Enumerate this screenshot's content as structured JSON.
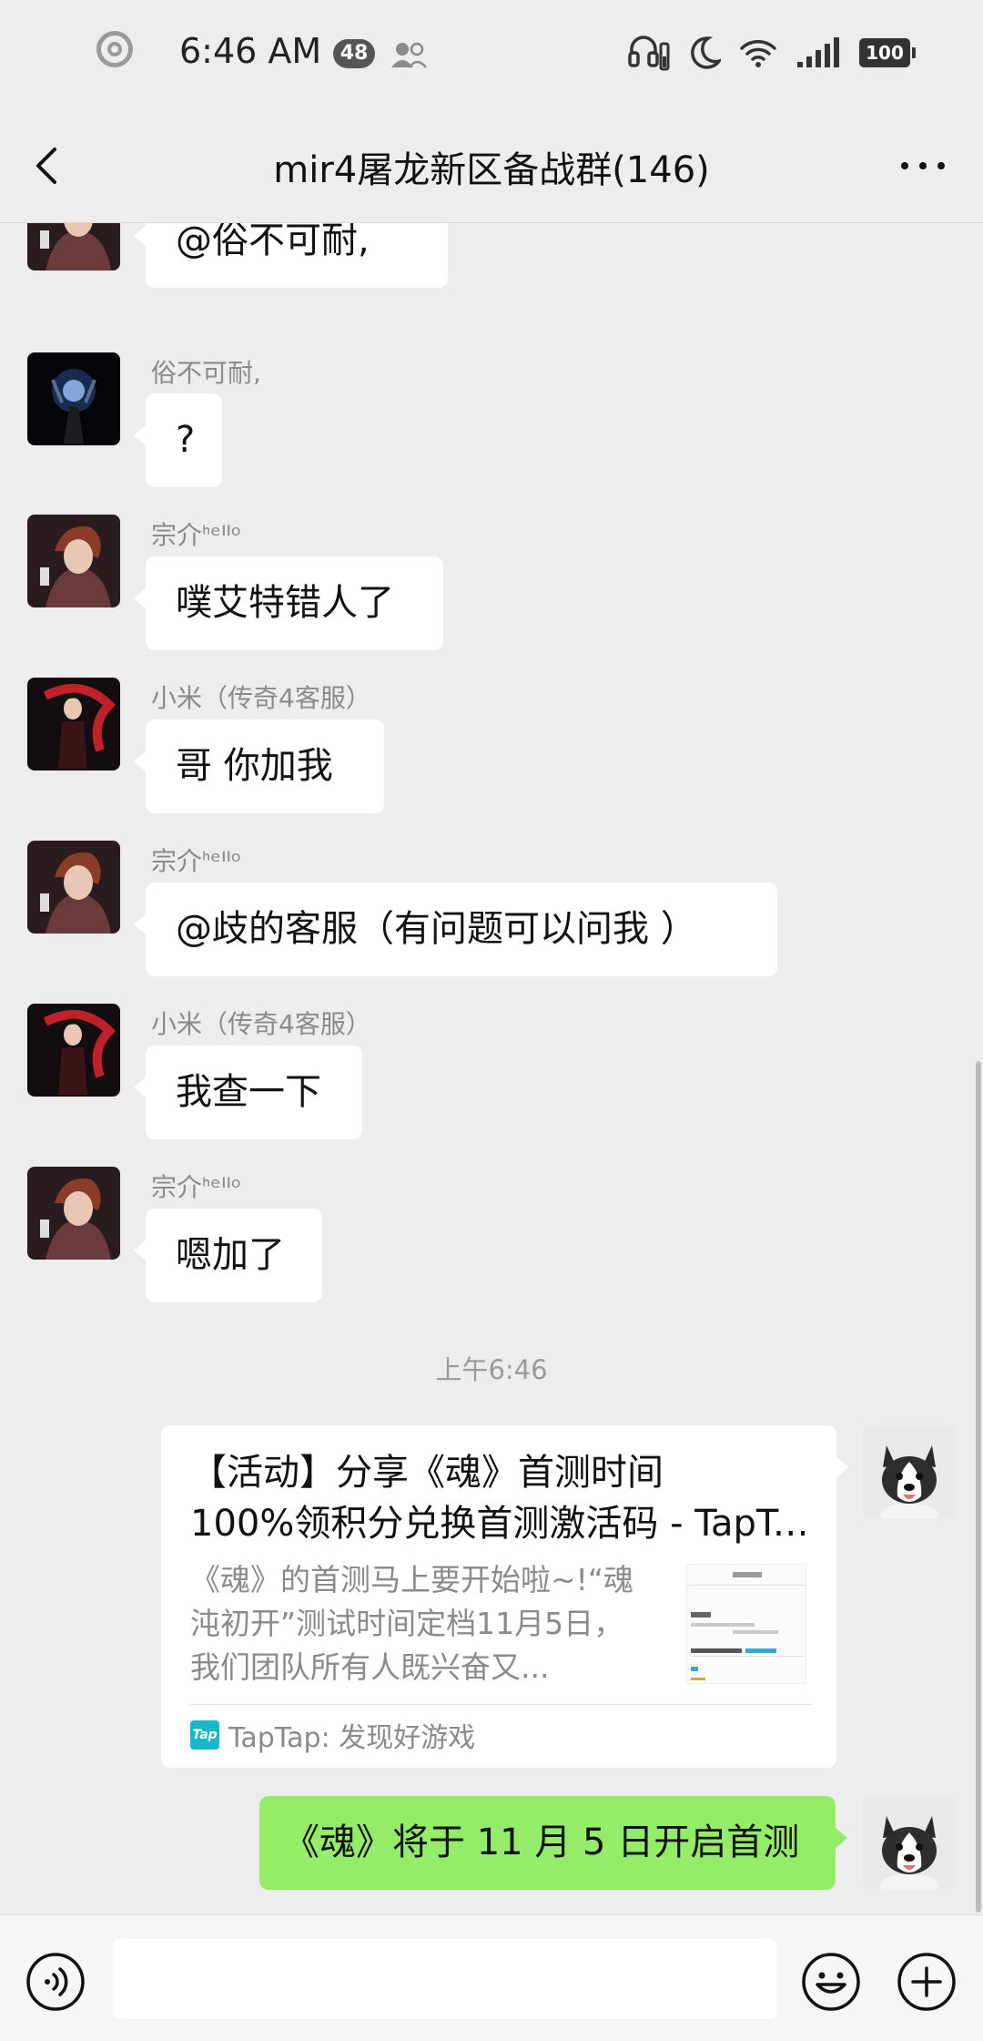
{
  "status_bar": {
    "time": "6:46 AM",
    "notification_count": "48",
    "battery": "100"
  },
  "header": {
    "title": "mir4屠龙新区备战群(146)"
  },
  "messages": [
    {
      "sender": "",
      "text": "@俗不可耐,"
    },
    {
      "sender": "俗不可耐,",
      "text": "?"
    },
    {
      "sender": "宗介ᑋᵉᑊᑊᵒ",
      "text": "噗艾特错人了"
    },
    {
      "sender": "小米（传奇4客服）",
      "text": "哥  你加我"
    },
    {
      "sender": "宗介ᑋᵉᑊᑊᵒ",
      "text": "@歧的客服（有问题可以问我 ）"
    },
    {
      "sender": "小米（传奇4客服）",
      "text": "我查一下"
    },
    {
      "sender": "宗介ᑋᵉᑊᑊᵒ",
      "text": "嗯加了"
    }
  ],
  "timestamp": "上午6:46",
  "link_card": {
    "title_line1": "【活动】分享《魂》首测时间",
    "title_line2": "100%领积分兑换首测激活码 - TapTap...",
    "description": "《魂》的首测马上要开始啦~!“魂沌初开”测试时间定档11月5日，我们团队所有人既兴奋又...",
    "source": "TapTap: 发现好游戏",
    "source_logo": "Tap"
  },
  "my_message": "《魂》将于 11 月 5 日开启首测",
  "colors": {
    "background": "#ededed",
    "my_bubble": "#95ec69",
    "other_bubble": "#ffffff"
  }
}
